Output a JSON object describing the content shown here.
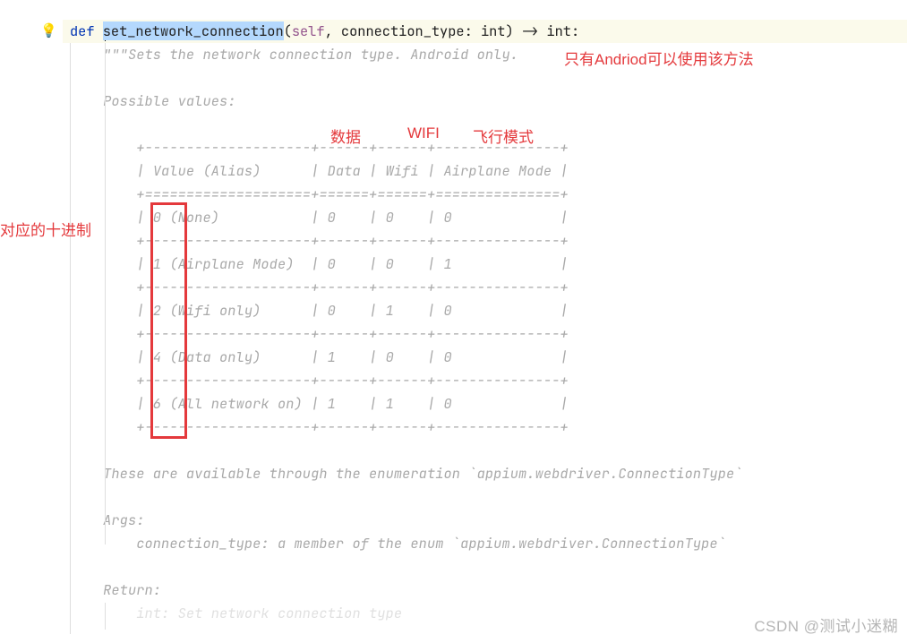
{
  "signature": {
    "def": "def ",
    "fn_name": "set_network_connection",
    "open": "(",
    "self": "self",
    "comma": ", ",
    "param": "connection_type",
    "colon1": ": ",
    "ptype": "int",
    "close": ")",
    "arrow": " -> ",
    "rtype": "int",
    "end": ":"
  },
  "doc": {
    "l1": "\"\"\"Sets the network connection type. Android only.",
    "blank": "",
    "possible": "Possible values:",
    "sep_top": "    +--------------------+------+------+---------------+",
    "hdr": "    | Value (Alias)      | Data | Wifi | Airplane Mode |",
    "sep_hdr": "    +====================+======+======+===============+",
    "r0": "    | 0 (None)           | 0    | 0    | 0             |",
    "sep": "    +--------------------+------+------+---------------+",
    "r1": "    | 1 (Airplane Mode)  | 0    | 0    | 1             |",
    "r2": "    | 2 (Wifi only)      | 0    | 1    | 0             |",
    "r4": "    | 4 (Data only)      | 1    | 0    | 0             |",
    "r6": "    | 6 (All network on) | 1    | 1    | 0             |",
    "these": "These are available through the enumeration `appium.webdriver.ConnectionType`",
    "args": "Args:",
    "args_desc": "    connection_type: a member of the enum `appium.webdriver.ConnectionType`",
    "return": "Return:",
    "ret_desc": "    int: Set network connection type"
  },
  "annotations": {
    "android_only": "只有Andriod可以使用该方法",
    "col_data": "数据",
    "col_wifi": "WIFI",
    "col_airplane": "飞行模式",
    "decimal": "对应的十进制"
  },
  "watermark": "CSDN @测试小迷糊"
}
